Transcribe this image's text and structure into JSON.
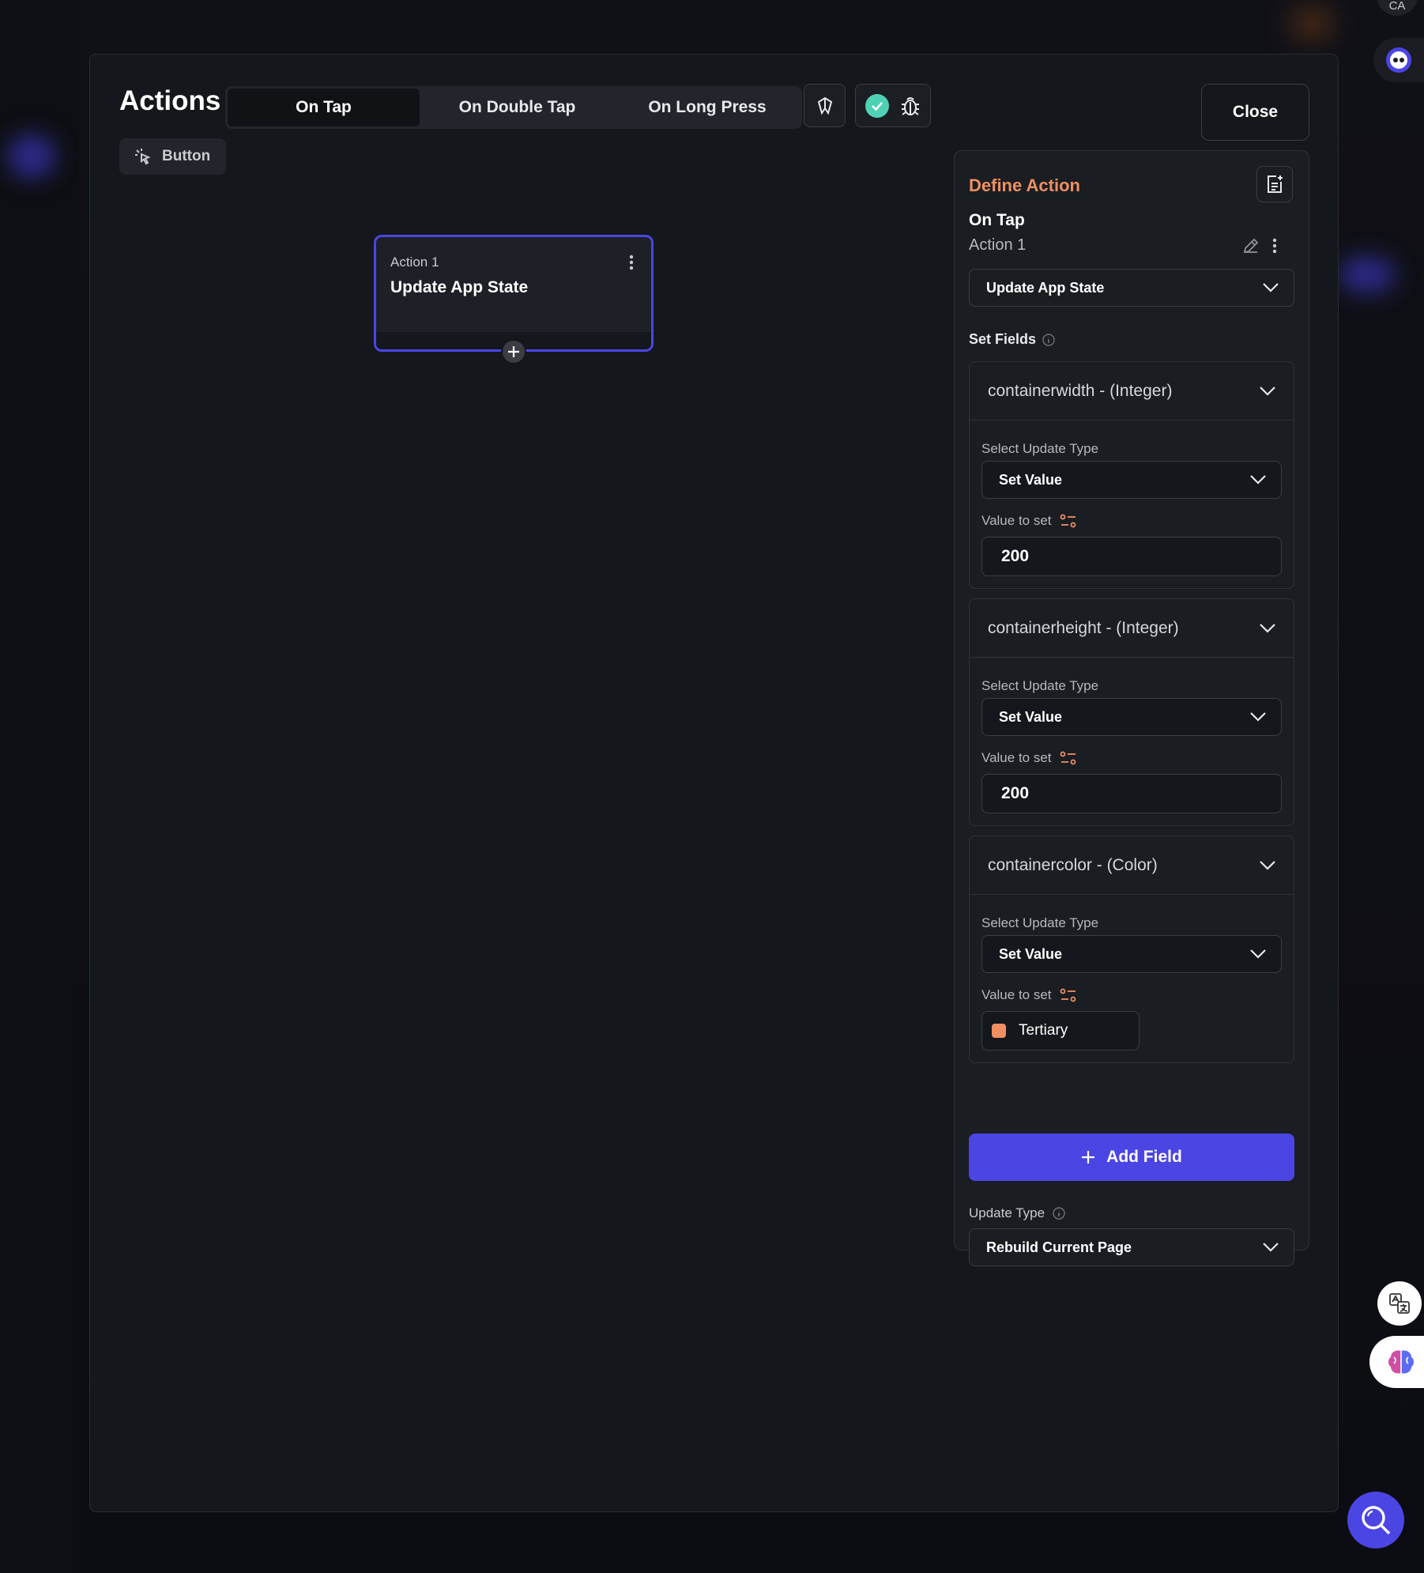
{
  "header": {
    "title": "Actions",
    "tabs": [
      {
        "label": "On Tap",
        "active": true
      },
      {
        "label": "On Double Tap",
        "active": false
      },
      {
        "label": "On Long Press",
        "active": false
      }
    ],
    "close_label": "Close",
    "corner_text": "CA"
  },
  "widget_chip": {
    "label": "Button",
    "icon": "tap-pointer-icon"
  },
  "action_card": {
    "label": "Action 1",
    "name": "Update App State"
  },
  "panel": {
    "title": "Define Action",
    "trigger": "On Tap",
    "action_name": "Action 1",
    "action_type": "Update App State",
    "set_fields_label": "Set Fields",
    "fields": [
      {
        "header": "containerwidth - (Integer)",
        "update_type_label": "Select Update Type",
        "update_type": "Set Value",
        "value_label": "Value to set",
        "value": "200"
      },
      {
        "header": "containerheight - (Integer)",
        "update_type_label": "Select Update Type",
        "update_type": "Set Value",
        "value_label": "Value to set",
        "value": "200"
      },
      {
        "header": "containercolor - (Color)",
        "update_type_label": "Select Update Type",
        "update_type": "Set Value",
        "value_label": "Value to set",
        "value": "Tertiary",
        "swatch_color": "#ef8f62"
      }
    ],
    "add_field_label": "Add Field",
    "update_type_label": "Update Type",
    "update_type_value": "Rebuild Current Page"
  },
  "colors": {
    "accent": "#4b45e4",
    "title_orange": "#ef8f62",
    "check_green": "#4fd1b5"
  }
}
